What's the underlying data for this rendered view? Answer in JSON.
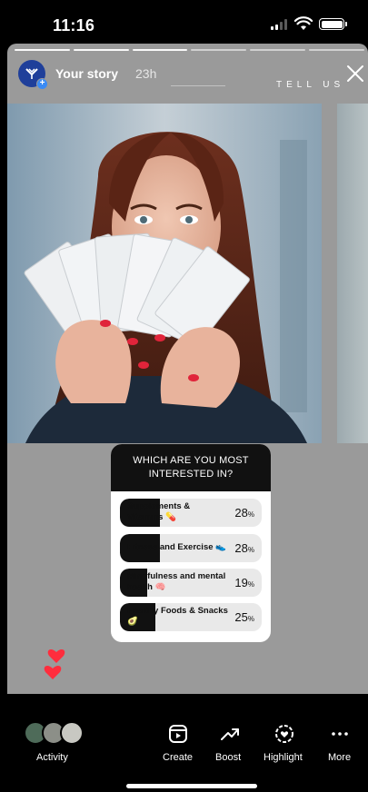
{
  "status": {
    "time": "11:16"
  },
  "story": {
    "username": "Your story",
    "age": "23h",
    "tell_us": "TELL US"
  },
  "poll": {
    "question_line1": "WHICH ARE YOU MOST",
    "question_line2": "INTERESTED IN?",
    "options": [
      {
        "label_line1": "Supplements &",
        "label_line2": "Vitamins 💊",
        "percent": "28",
        "unit": "%",
        "fill": 0.28
      },
      {
        "label_line1": "Fitness and Exercise 👟",
        "label_line2": "",
        "percent": "28",
        "unit": "%",
        "fill": 0.28
      },
      {
        "label_line1": "Mindfulness and mental",
        "label_line2": "health 🧠",
        "percent": "19",
        "unit": "%",
        "fill": 0.19
      },
      {
        "label_line1": "Healthy Foods & Snacks",
        "label_line2": "🥑",
        "percent": "25",
        "unit": "%",
        "fill": 0.25
      }
    ]
  },
  "bottom_bar": {
    "activity": "Activity",
    "create": "Create",
    "boost": "Boost",
    "highlight": "Highlight",
    "more": "More"
  },
  "colors": {
    "accent_blue": "#3a8bf5",
    "heart": "#ff2d3d",
    "story_bg": "#9a9a9a"
  },
  "icons": [
    "signal-icon",
    "wifi-icon",
    "battery-icon",
    "close-icon",
    "heart-icon",
    "create-icon",
    "boost-icon",
    "highlight-icon",
    "more-icon"
  ]
}
